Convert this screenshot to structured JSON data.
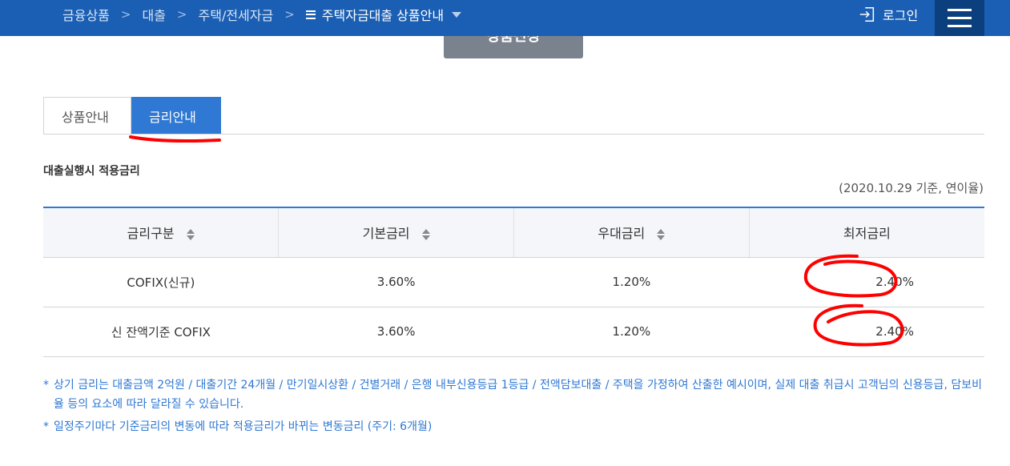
{
  "breadcrumb": {
    "items": [
      "금융상품",
      "대출",
      "주택/전세자금"
    ],
    "separator": ">",
    "current": "주택자금대출 상품안내"
  },
  "header": {
    "login_label": "로그인",
    "login_icon": "login-icon",
    "menu_icon": "hamburger-icon"
  },
  "apply_button": {
    "label": "상품신청"
  },
  "tabs": [
    {
      "label": "상품안내",
      "active": false
    },
    {
      "label": "금리안내",
      "active": true
    }
  ],
  "section": {
    "title": "대출실행시 적용금리",
    "basis_note": "(2020.10.29 기준, 연이율)"
  },
  "rate_table": {
    "headers": [
      "금리구분",
      "기본금리",
      "우대금리",
      "최저금리"
    ],
    "rows": [
      {
        "type": "COFIX(신규)",
        "base_rate": "3.60%",
        "preferential_rate": "1.20%",
        "min_rate": "2.40%"
      },
      {
        "type": "신 잔액기준 COFIX",
        "base_rate": "3.60%",
        "preferential_rate": "1.20%",
        "min_rate": "2.40%"
      }
    ]
  },
  "notes": [
    "상기 금리는 대출금액 2억원 / 대출기간 24개월 / 만기일시상환 / 건별거래 / 은행 내부신용등급 1등급 / 전액담보대출 / 주택을 가정하여 산출한 예시이며, 실제 대출 취급시 고객님의 신용등급, 담보비율 등의 요소에 따라 달라질 수 있습니다.",
    "일정주기마다 기준금리의 변동에 따라 적용금리가 바뀌는 변동금리 (주기: 6개월)"
  ],
  "colors": {
    "header_bg": "#1b5fb4",
    "menu_bg": "#0c3f7e",
    "active_tab": "#2f78d4",
    "note_text": "#2f78d4",
    "annotation": "#ff0000"
  }
}
